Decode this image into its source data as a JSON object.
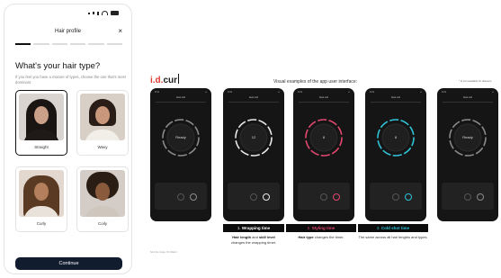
{
  "phone": {
    "header_title": "Hair profile",
    "close_symbol": "×",
    "progress_steps": 6,
    "progress_active": 1,
    "question": "What's your hair type?",
    "subtitle": "If you feel you have a mixture of types, choose the one that's most dominant",
    "options": [
      {
        "label": "Straight",
        "selected": true
      },
      {
        "label": "Wavy",
        "selected": false
      },
      {
        "label": "Curly",
        "selected": false
      },
      {
        "label": "Coily",
        "selected": false
      }
    ],
    "continue_label": "Continue"
  },
  "slide": {
    "logo_part1": "i.d.",
    "logo_part2": "cur",
    "title": "Visual examples of the app user interface:",
    "note": "* id.curl available for distance",
    "screens": [
      {
        "ring_text": "Ready",
        "accent": "#8a8a8a"
      },
      {
        "ring_text": "12",
        "accent": "#e8e8e8"
      },
      {
        "ring_text": "8",
        "accent": "#e3476f"
      },
      {
        "ring_text": "8",
        "accent": "#2fc4d8"
      },
      {
        "ring_text": "Ready",
        "accent": "#8a8a8a"
      }
    ],
    "captions": [
      {
        "num": "1.",
        "name": "Wrapping time",
        "color": "#ffffff"
      },
      {
        "num": "2.",
        "name": "Styling time",
        "color": "#e3476f"
      },
      {
        "num": "3.",
        "name": "Cold shot time",
        "color": "#2fc4d8"
      }
    ],
    "desc1_b1": "Hair length",
    "desc1_mid": " and ",
    "desc1_b2": "skill level",
    "desc1_end": "changes the wrapping timer.",
    "desc2_b": "Hair type",
    "desc2_end": " changes the timer.",
    "desc3": "The same across all hair lengths and types.",
    "footnote": "Spot the image: ID.inflated"
  }
}
